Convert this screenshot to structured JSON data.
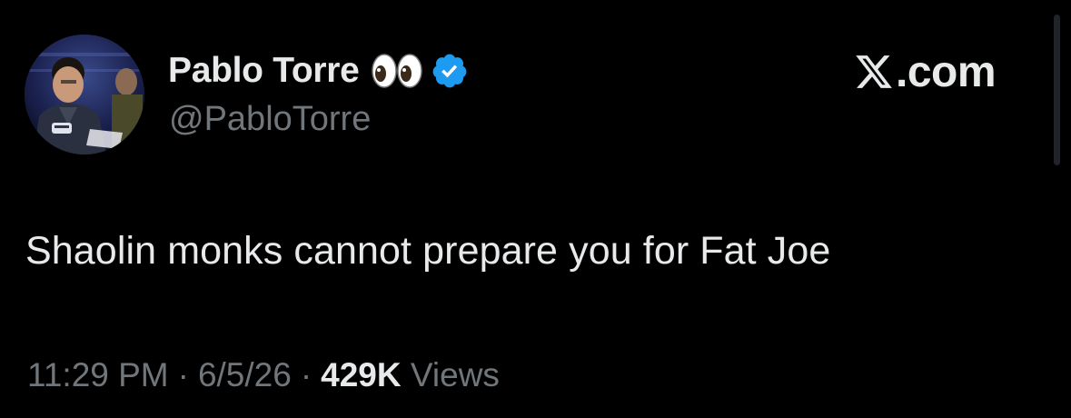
{
  "author": {
    "display_name": "Pablo Torre",
    "handle": "@PabloTorre",
    "name_emoji": "eyes-icon",
    "verified": true,
    "verified_color": "#1d9bf0"
  },
  "brand": {
    "logo": "x-logo-icon",
    "text": ".com"
  },
  "tweet": {
    "text": "Shaolin monks cannot prepare you for Fat Joe"
  },
  "meta": {
    "time": "11:29 PM",
    "separator": "·",
    "date": "6/5/26",
    "views_count": "429K",
    "views_label": "Views"
  },
  "colors": {
    "background": "#000000",
    "primary_text": "#e7e9ea",
    "secondary_text": "#71767b",
    "verified_blue": "#1d9bf0"
  }
}
